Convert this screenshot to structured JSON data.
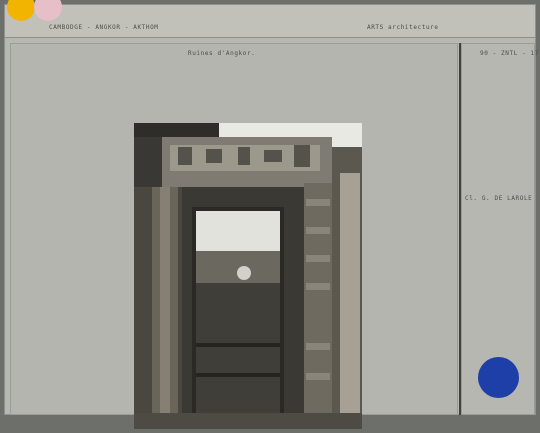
{
  "header": {
    "location": "CAMBODGE - ANGKOR - AKTHOM",
    "category": "ARTS architecture"
  },
  "caption": "Ruines d'Angkor.",
  "reference": "90 - ZNTL - 17",
  "credit": "Cl. G. DE LAROLE",
  "colors": {
    "yellow_sticker": "#f2b400",
    "pink_sticker": "#e6bfc9",
    "blue_sticker": "#1e3fa8",
    "card_background": "#b8b8b2",
    "page_background": "#6c6f6a"
  }
}
